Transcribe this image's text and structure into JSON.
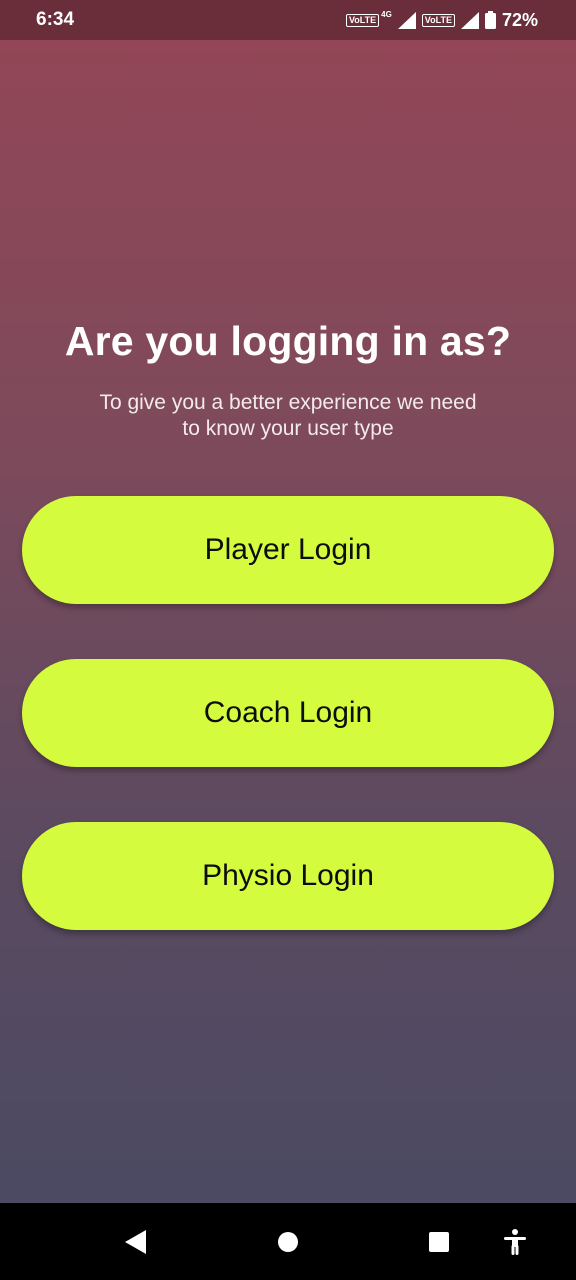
{
  "status_bar": {
    "time": "6:34",
    "volte_1": "VoLTE",
    "network_type": "4G",
    "volte_2": "VoLTE",
    "battery": "72%"
  },
  "main": {
    "title": "Are you logging in as?",
    "subtitle": "To give you a better experience we need to know your user type",
    "buttons": [
      {
        "label": "Player Login"
      },
      {
        "label": "Coach Login"
      },
      {
        "label": "Physio Login"
      }
    ]
  },
  "colors": {
    "gradient_top": "#944656",
    "gradient_bottom": "#474a63",
    "status_bar": "#6a2e3b",
    "button": "#d4fb3e",
    "button_text": "#0d0d0d",
    "nav_bar": "#000000"
  },
  "icons": {
    "signal": "signal-icon",
    "battery": "battery-icon",
    "back": "back-icon",
    "home": "home-icon",
    "recents": "recents-icon",
    "accessibility": "accessibility-icon"
  }
}
